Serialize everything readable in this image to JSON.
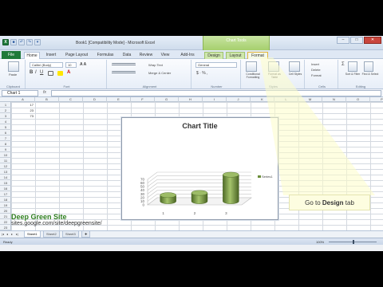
{
  "app": {
    "title": "Book1 [Compatibility Mode] - Microsoft Excel",
    "contextual_group": "Chart Tools",
    "window_controls": [
      "–",
      "□",
      "✕"
    ]
  },
  "tabs": {
    "file": "File",
    "items": [
      "Home",
      "Insert",
      "Page Layout",
      "Formulas",
      "Data",
      "Review",
      "View",
      "Add-Ins"
    ],
    "chart_tools": [
      "Design",
      "Layout",
      "Format"
    ],
    "active": "Home",
    "highlighted": "Format"
  },
  "ribbon": {
    "clipboard": {
      "paste": "Paste",
      "label": "Clipboard"
    },
    "font": {
      "name": "Calibri (Body)",
      "size": "10",
      "label": "Font"
    },
    "alignment": {
      "wrap": "Wrap Text",
      "merge": "Merge & Center",
      "label": "Alignment"
    },
    "number": {
      "format": "General",
      "label": "Number"
    },
    "styles": {
      "conditional": "Conditional Formatting",
      "table": "Format as Table",
      "cell": "Cell Styles",
      "label": "Styles"
    },
    "cells": {
      "insert": "Insert",
      "delete": "Delete",
      "format": "Format",
      "label": "Cells"
    },
    "editing": {
      "sort": "Sort & Filter",
      "find": "Find & Select",
      "label": "Editing"
    }
  },
  "formula_bar": {
    "name_box": "Chart 1",
    "fx": "fx",
    "value": ""
  },
  "grid": {
    "columns": [
      "A",
      "B",
      "C",
      "D",
      "E",
      "F",
      "G",
      "H",
      "I",
      "J",
      "K",
      "L",
      "M",
      "N",
      "O",
      "P"
    ],
    "rows": [
      "1",
      "2",
      "3",
      "4",
      "5",
      "6",
      "7",
      "8",
      "9",
      "10",
      "11",
      "12",
      "13",
      "14",
      "15",
      "16",
      "17",
      "18",
      "19",
      "20",
      "21",
      "22",
      "23",
      "24",
      "25"
    ],
    "a_values": [
      "17",
      "23",
      "73"
    ]
  },
  "chart_data": {
    "type": "bar",
    "title": "Chart Title",
    "categories": [
      "1",
      "2",
      "3"
    ],
    "series": [
      {
        "name": "Series1",
        "values": [
          17,
          23,
          73
        ]
      }
    ],
    "ylim": [
      0,
      70
    ],
    "yticks": [
      "0",
      "10",
      "20",
      "30",
      "40",
      "50",
      "60",
      "70"
    ],
    "legend": "right",
    "style": "3-D cylinder",
    "color": "#6b8e3a"
  },
  "callout": {
    "prefix": "Go to ",
    "bold": "Design",
    "suffix": " tab"
  },
  "watermark": {
    "title": "Deep Green Site",
    "url": "sites.google.com/site/deepgreensite/"
  },
  "sheets": [
    "Sheet1",
    "Sheet2",
    "Sheet3"
  ],
  "status": {
    "ready": "Ready",
    "zoom": "100%"
  }
}
